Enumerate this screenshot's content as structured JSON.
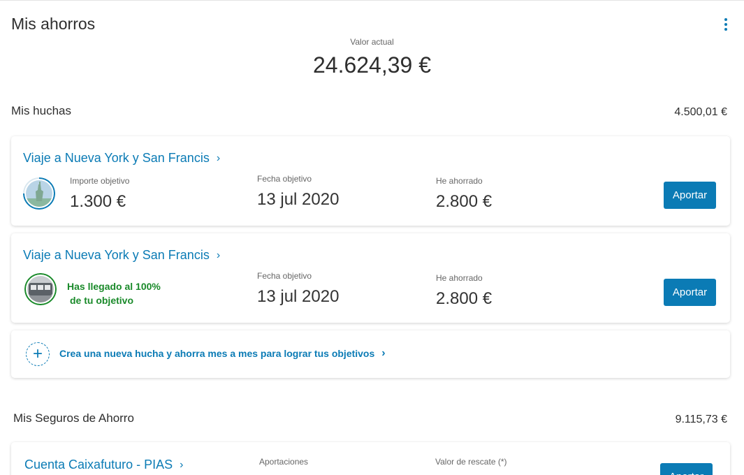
{
  "header": {
    "title": "Mis ahorros",
    "total_label": "Valor actual",
    "total_value": "24.624,39 €"
  },
  "huchas": {
    "title": "Mis huchas",
    "amount": "4.500,01 €",
    "cards": [
      {
        "title": "Viaje a Nueva York y San Francis",
        "target_label": "Importe objetivo",
        "target_value": "1.300 €",
        "date_label": "Fecha objetivo",
        "date_value": "13 jul 2020",
        "saved_label": "He ahorrado",
        "saved_value": "2.800 €",
        "button": "Aportar"
      },
      {
        "title": "Viaje a Nueva York y San Francis",
        "reached_line1": "Has llegado al 100%",
        "reached_line2": "de tu objetivo",
        "date_label": "Fecha objetivo",
        "date_value": "13 jul 2020",
        "saved_label": "He ahorrado",
        "saved_value": "2.800 €",
        "button": "Aportar"
      }
    ],
    "create_text": "Crea una nueva hucha y ahorra mes a mes para lograr tus objetivos"
  },
  "seguros": {
    "title": "Mis Seguros de Ahorro",
    "amount": "9.115,73 €",
    "card": {
      "title": "Cuenta Caixafuturo - PIAS",
      "contrib_label": "Aportaciones",
      "rescue_label": "Valor de rescate (*)",
      "button": "Aportar"
    }
  },
  "icons": {
    "more": "more-vertical-icon",
    "chevron": "chevron-right-icon",
    "plus": "plus-icon"
  },
  "colors": {
    "accent": "#0b7bb5",
    "success": "#1a8a2a"
  }
}
